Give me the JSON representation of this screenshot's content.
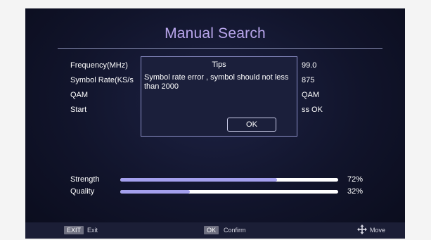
{
  "screen": {
    "title": "Manual Search"
  },
  "settings": [
    {
      "label": "Frequency(MHz)",
      "value": "99.0"
    },
    {
      "label": "Symbol Rate(KS/s",
      "value": "875"
    },
    {
      "label": "QAM",
      "value": "QAM"
    },
    {
      "label": "Start",
      "value": "ss OK"
    }
  ],
  "dialog": {
    "title": "Tips",
    "message": "Symbol rate error , symbol should not less than 2000",
    "ok_label": "OK"
  },
  "signal": {
    "strength_label": "Strength",
    "strength_percent_text": "72%",
    "strength_value": 72,
    "quality_label": "Quality",
    "quality_percent_text": "32%",
    "quality_value": 32,
    "fill_color": "#a4a0ee",
    "track_color": "#ffffff"
  },
  "footer": {
    "exit_key": "EXIT",
    "exit_label": "Exit",
    "ok_key": "OK",
    "confirm_label": "Confirm",
    "move_icon": "four-way-arrow-icon",
    "move_label": "Move"
  },
  "colors": {
    "title": "#b9a6ec",
    "dialog_border": "#8d90c8",
    "background": "#11142b"
  }
}
